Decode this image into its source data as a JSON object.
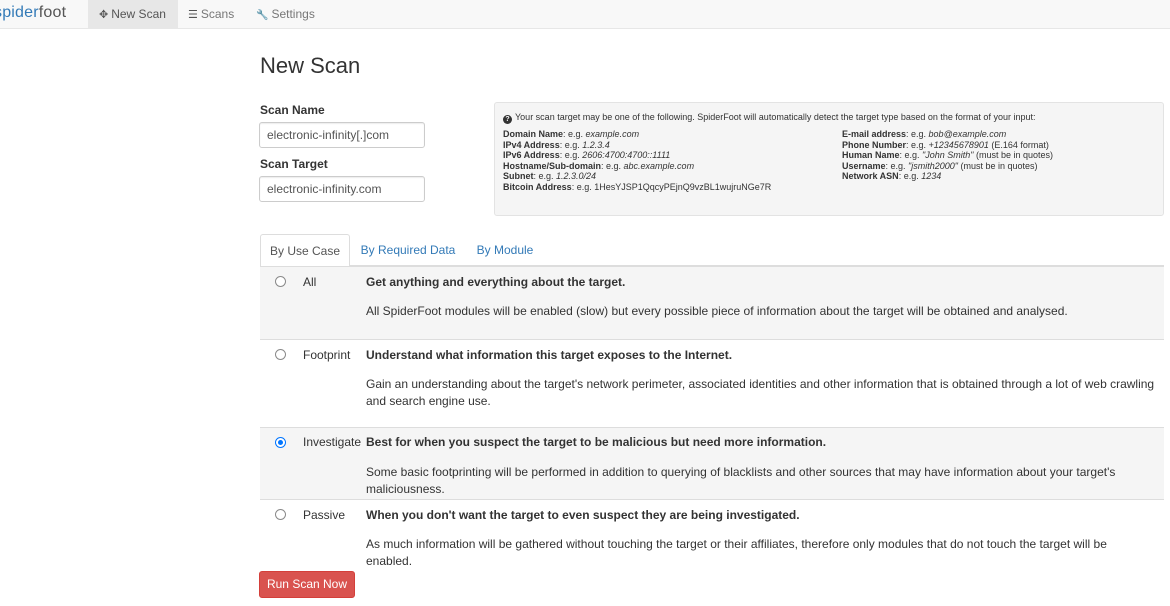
{
  "navbar": {
    "brand_part1": "spider",
    "brand_part2": "foot",
    "items": [
      {
        "icon": "crosshairs-icon",
        "glyph": "✥",
        "label": "New Scan",
        "active": true
      },
      {
        "icon": "list-icon",
        "glyph": "☰",
        "label": "Scans",
        "active": false
      },
      {
        "icon": "wrench-icon",
        "glyph": "🔧",
        "label": "Settings",
        "active": false
      }
    ]
  },
  "page": {
    "title": "New Scan"
  },
  "form": {
    "scan_name_label": "Scan Name",
    "scan_name_value": "electronic-infinity[.]com",
    "scan_target_label": "Scan Target",
    "scan_target_value": "electronic-infinity.com"
  },
  "help": {
    "intro": "Your scan target may be one of the following. SpiderFoot will automatically detect the target type based on the format of your input:",
    "left": [
      {
        "name": "Domain Name",
        "prefix": ": e.g. ",
        "example": "example.com",
        "suffix": ""
      },
      {
        "name": "IPv4 Address",
        "prefix": ": e.g. ",
        "example": "1.2.3.4",
        "suffix": ""
      },
      {
        "name": "IPv6 Address",
        "prefix": ": e.g. ",
        "example": "2606:4700:4700::1111",
        "suffix": ""
      },
      {
        "name": "Hostname/Sub-domain",
        "prefix": ": e.g. ",
        "example": "abc.example.com",
        "suffix": ""
      },
      {
        "name": "Subnet",
        "prefix": ": e.g. ",
        "example": "1.2.3.0/24",
        "suffix": ""
      },
      {
        "name": "Bitcoin Address",
        "prefix": ": e.g. 1HesYJSP1QqcyPEjnQ9vzBL1wujruNGe7R",
        "example": "",
        "suffix": ""
      }
    ],
    "right": [
      {
        "name": "E-mail address",
        "prefix": ": e.g. ",
        "example": "bob@example.com",
        "suffix": ""
      },
      {
        "name": "Phone Number",
        "prefix": ": e.g. ",
        "example": "+12345678901",
        "suffix": " (E.164 format)"
      },
      {
        "name": "Human Name",
        "prefix": ": e.g. ",
        "example": "\"John Smith\"",
        "suffix": " (must be in quotes)"
      },
      {
        "name": "Username",
        "prefix": ": e.g. ",
        "example": "\"jsmith2000\"",
        "suffix": " (must be in quotes)"
      },
      {
        "name": "Network ASN",
        "prefix": ": e.g. ",
        "example": "1234",
        "suffix": ""
      }
    ]
  },
  "tabs": [
    {
      "label": "By Use Case",
      "active": true
    },
    {
      "label": "By Required Data",
      "active": false
    },
    {
      "label": "By Module",
      "active": false
    }
  ],
  "use_cases": [
    {
      "name": "All",
      "title": "Get anything and everything about the target.",
      "description": "All SpiderFoot modules will be enabled (slow) but every possible piece of information about the target will be obtained and analysed.",
      "selected": false
    },
    {
      "name": "Footprint",
      "title": "Understand what information this target exposes to the Internet.",
      "description": "Gain an understanding about the target's network perimeter, associated identities and other information that is obtained through a lot of web crawling and search engine use.",
      "selected": false
    },
    {
      "name": "Investigate",
      "title": "Best for when you suspect the target to be malicious but need more information.",
      "description": "Some basic footprinting will be performed in addition to querying of blacklists and other sources that may have information about your target's maliciousness.",
      "selected": true
    },
    {
      "name": "Passive",
      "title": "When you don't want the target to even suspect they are being investigated.",
      "description": "As much information will be gathered without touching the target or their affiliates, therefore only modules that do not touch the target will be enabled.",
      "selected": false
    }
  ],
  "run_button_label": "Run Scan Now",
  "colors": {
    "accent": "#337ab7",
    "danger": "#d9534f",
    "radio_checked": "#0075ff"
  }
}
